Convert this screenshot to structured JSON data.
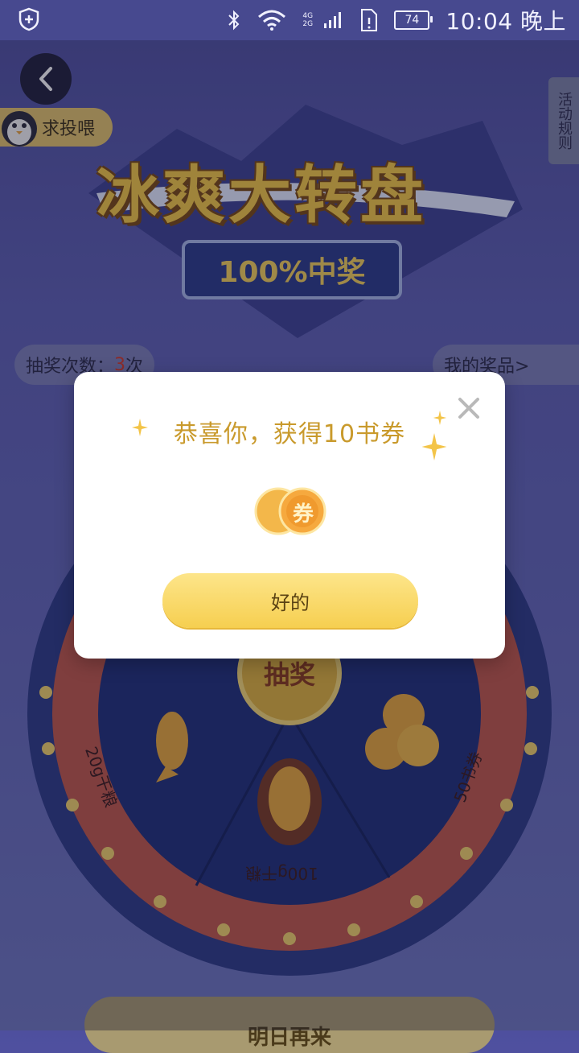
{
  "status_bar": {
    "time": "10:04 晚上",
    "battery": "74",
    "network": "4G 2G"
  },
  "header": {
    "back_icon": "chevron-left-icon",
    "promo_bubble": "求投喂",
    "rules_tab": "活动规则"
  },
  "hero": {
    "title": "冰爽大转盘",
    "subtitle": "100%中奖"
  },
  "draw_info": {
    "count_label": "抽奖次数：",
    "count_value": "3",
    "count_unit": "次",
    "my_prizes": "我的奖品>"
  },
  "wheel": {
    "center_button": "抽奖",
    "segments": [
      "20g干粮",
      "100g干粮",
      "50书券"
    ]
  },
  "bottom_button": "明日再来",
  "dialog": {
    "message": "恭喜你，获得10书券",
    "coin_glyph": "券",
    "ok_label": "好的",
    "close_icon": "close-icon"
  },
  "colors": {
    "accent_gold": "#f6cf50",
    "message_gold": "#c99a2c",
    "background_purple": "#5d5fb3"
  }
}
